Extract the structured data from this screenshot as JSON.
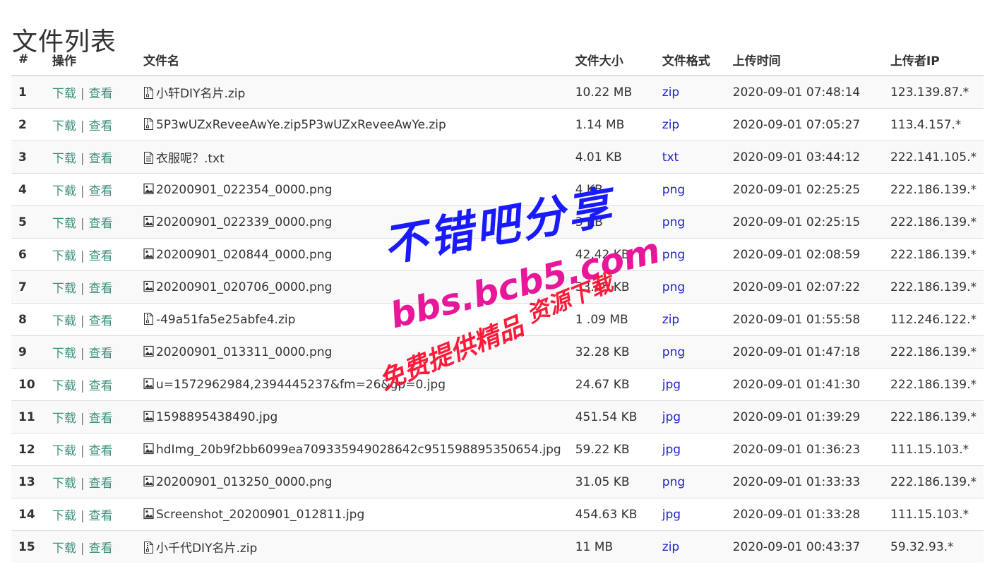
{
  "page": {
    "title": "文件列表"
  },
  "table": {
    "headers": [
      "#",
      "操作",
      "文件名",
      "文件大小",
      "文件格式",
      "上传时间",
      "上传者IP"
    ],
    "download_label": "下载",
    "separator": "|",
    "view_label": "查看",
    "rows": [
      {
        "num": "1",
        "name": "小轩DIY名片.zip",
        "icon": "zip-file-icon",
        "size": "10.22 MB",
        "format": "zip",
        "time": "2020-09-01 07:48:14",
        "ip": "123.139.87.*"
      },
      {
        "num": "2",
        "name": "5P3wUZxReveeAwYe.zip5P3wUZxReveeAwYe.zip",
        "icon": "zip-file-icon",
        "size": "1.14 MB",
        "format": "zip",
        "time": "2020-09-01 07:05:27",
        "ip": "113.4.157.*"
      },
      {
        "num": "3",
        "name": "衣服呢？.txt",
        "icon": "text-file-icon",
        "size": "4.01 KB",
        "format": "txt",
        "time": "2020-09-01 03:44:12",
        "ip": "222.141.105.*"
      },
      {
        "num": "4",
        "name": "20200901_022354_0000.png",
        "icon": "image-file-icon",
        "size": "4 KB",
        "format": "png",
        "time": "2020-09-01 02:25:25",
        "ip": "222.186.139.*"
      },
      {
        "num": "5",
        "name": "20200901_022339_0000.png",
        "icon": "image-file-icon",
        "size": "3 KB",
        "format": "png",
        "time": "2020-09-01 02:25:15",
        "ip": "222.186.139.*"
      },
      {
        "num": "6",
        "name": "20200901_020844_0000.png",
        "icon": "image-file-icon",
        "size": "42.42 KB",
        "format": "png",
        "time": "2020-09-01 02:08:59",
        "ip": "222.186.139.*"
      },
      {
        "num": "7",
        "name": "20200901_020706_0000.png",
        "icon": "image-file-icon",
        "size": "33.45 KB",
        "format": "png",
        "time": "2020-09-01 02:07:22",
        "ip": "222.186.139.*"
      },
      {
        "num": "8",
        "name": "-49a51fa5e25abfe4.zip",
        "icon": "zip-file-icon",
        "size": "1 .09 MB",
        "format": "zip",
        "time": "2020-09-01 01:55:58",
        "ip": "112.246.122.*"
      },
      {
        "num": "9",
        "name": "20200901_013311_0000.png",
        "icon": "image-file-icon",
        "size": "32.28 KB",
        "format": "png",
        "time": "2020-09-01 01:47:18",
        "ip": "222.186.139.*"
      },
      {
        "num": "10",
        "name": "u=1572962984,2394445237&fm=26&gp=0.jpg",
        "icon": "image-file-icon",
        "size": "24.67 KB",
        "format": "jpg",
        "time": "2020-09-01 01:41:30",
        "ip": "222.186.139.*"
      },
      {
        "num": "11",
        "name": "1598895438490.jpg",
        "icon": "image-file-icon",
        "size": "451.54 KB",
        "format": "jpg",
        "time": "2020-09-01 01:39:29",
        "ip": "222.186.139.*"
      },
      {
        "num": "12",
        "name": "hdImg_20b9f2bb6099ea709335949028642c951598895350654.jpg",
        "icon": "image-file-icon",
        "size": "59.22 KB",
        "format": "jpg",
        "time": "2020-09-01 01:36:23",
        "ip": "111.15.103.*"
      },
      {
        "num": "13",
        "name": "20200901_013250_0000.png",
        "icon": "image-file-icon",
        "size": "31.05 KB",
        "format": "png",
        "time": "2020-09-01 01:33:33",
        "ip": "222.186.139.*"
      },
      {
        "num": "14",
        "name": "Screenshot_20200901_012811.jpg",
        "icon": "image-file-icon",
        "size": "454.63 KB",
        "format": "jpg",
        "time": "2020-09-01 01:33:28",
        "ip": "111.15.103.*"
      },
      {
        "num": "15",
        "name": "小千代DIY名片.zip",
        "icon": "zip-file-icon",
        "size": "11 MB",
        "format": "zip",
        "time": "2020-09-01 00:43:37",
        "ip": "59.32.93.*"
      }
    ]
  },
  "watermark": {
    "line1": "不错吧分享",
    "line2": "bbs.bcb5.com",
    "line3": "资源下载",
    "line4": "免费提供精品"
  },
  "colors": {
    "action_link": "#3d8f7c",
    "format_link": "#2222cc",
    "stripe": "#f9f9f9"
  }
}
